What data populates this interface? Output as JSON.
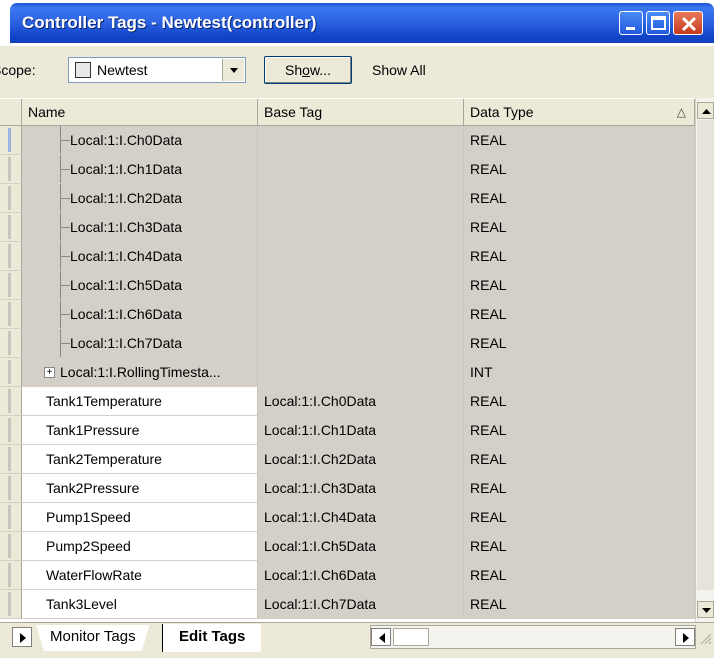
{
  "window": {
    "title": "Controller Tags - Newtest(controller)"
  },
  "toolbar": {
    "scope_label": "Scope:",
    "scope_value": "Newtest",
    "show_button": "Show...",
    "show_all": "Show All"
  },
  "grid": {
    "columns": [
      "Name",
      "Base Tag",
      "Data Type"
    ],
    "sort_indicator": "△",
    "rows": [
      {
        "name": "Local:1:I.Ch0Data",
        "base": "",
        "type": "REAL",
        "kind": "member"
      },
      {
        "name": "Local:1:I.Ch1Data",
        "base": "",
        "type": "REAL",
        "kind": "member"
      },
      {
        "name": "Local:1:I.Ch2Data",
        "base": "",
        "type": "REAL",
        "kind": "member"
      },
      {
        "name": "Local:1:I.Ch3Data",
        "base": "",
        "type": "REAL",
        "kind": "member"
      },
      {
        "name": "Local:1:I.Ch4Data",
        "base": "",
        "type": "REAL",
        "kind": "member"
      },
      {
        "name": "Local:1:I.Ch5Data",
        "base": "",
        "type": "REAL",
        "kind": "member"
      },
      {
        "name": "Local:1:I.Ch6Data",
        "base": "",
        "type": "REAL",
        "kind": "member"
      },
      {
        "name": "Local:1:I.Ch7Data",
        "base": "",
        "type": "REAL",
        "kind": "member"
      },
      {
        "name": "Local:1:I.RollingTimesta...",
        "base": "",
        "type": "INT",
        "kind": "member-expand"
      },
      {
        "name": "Tank1Temperature",
        "base": "Local:1:I.Ch0Data",
        "type": "REAL",
        "kind": "plain"
      },
      {
        "name": "Tank1Pressure",
        "base": "Local:1:I.Ch1Data",
        "type": "REAL",
        "kind": "plain"
      },
      {
        "name": "Tank2Temperature",
        "base": "Local:1:I.Ch2Data",
        "type": "REAL",
        "kind": "plain"
      },
      {
        "name": "Tank2Pressure",
        "base": "Local:1:I.Ch3Data",
        "type": "REAL",
        "kind": "plain"
      },
      {
        "name": "Pump1Speed",
        "base": "Local:1:I.Ch4Data",
        "type": "REAL",
        "kind": "plain"
      },
      {
        "name": "Pump2Speed",
        "base": "Local:1:I.Ch5Data",
        "type": "REAL",
        "kind": "plain"
      },
      {
        "name": "WaterFlowRate",
        "base": "Local:1:I.Ch6Data",
        "type": "REAL",
        "kind": "plain"
      },
      {
        "name": "Tank3Level",
        "base": "Local:1:I.Ch7Data",
        "type": "REAL",
        "kind": "plain"
      }
    ]
  },
  "tabs": {
    "monitor": "Monitor Tags",
    "edit": "Edit Tags"
  },
  "icons": {
    "expander": "+",
    "dropdown": "▼",
    "scroll_up": "▲",
    "scroll_down": "▼",
    "scroll_left": "◄",
    "scroll_right": "►"
  }
}
